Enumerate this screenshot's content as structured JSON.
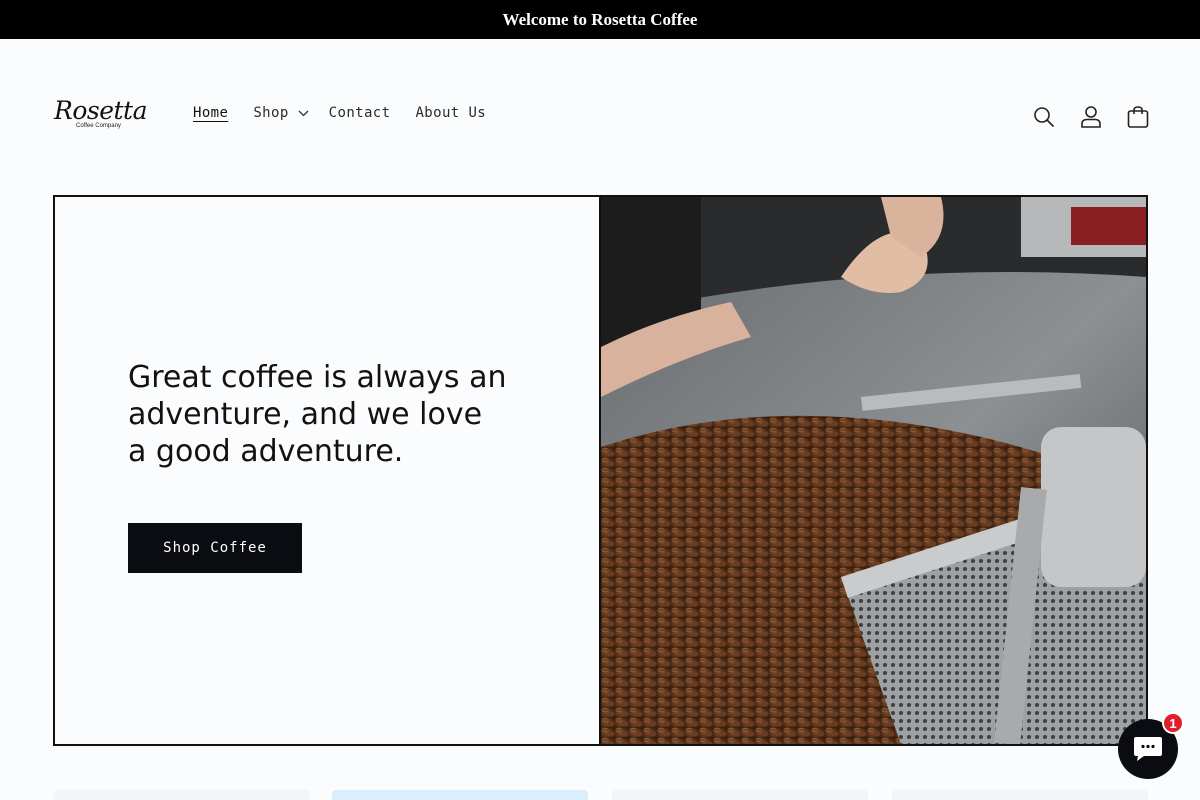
{
  "announcement": {
    "text": "Welcome to Rosetta Coffee"
  },
  "logo": {
    "script": "Rosetta",
    "subtitle": "Coffee Company"
  },
  "nav": {
    "home": "Home",
    "shop": "Shop",
    "contact": "Contact",
    "about": "About Us"
  },
  "header_icons": [
    "search-icon",
    "account-icon",
    "cart-icon"
  ],
  "hero": {
    "heading": "Great coffee is always an adventure, and we love a good adventure.",
    "button": "Shop Coffee",
    "image": "coffee-roaster-photo"
  },
  "chat": {
    "badge": "1",
    "icon": "chat-icon"
  },
  "colors": {
    "announcement_bg": "#000000",
    "button_bg": "#0a0c12",
    "badge": "#e11e2b",
    "page_bg": "#fbfcfd"
  }
}
